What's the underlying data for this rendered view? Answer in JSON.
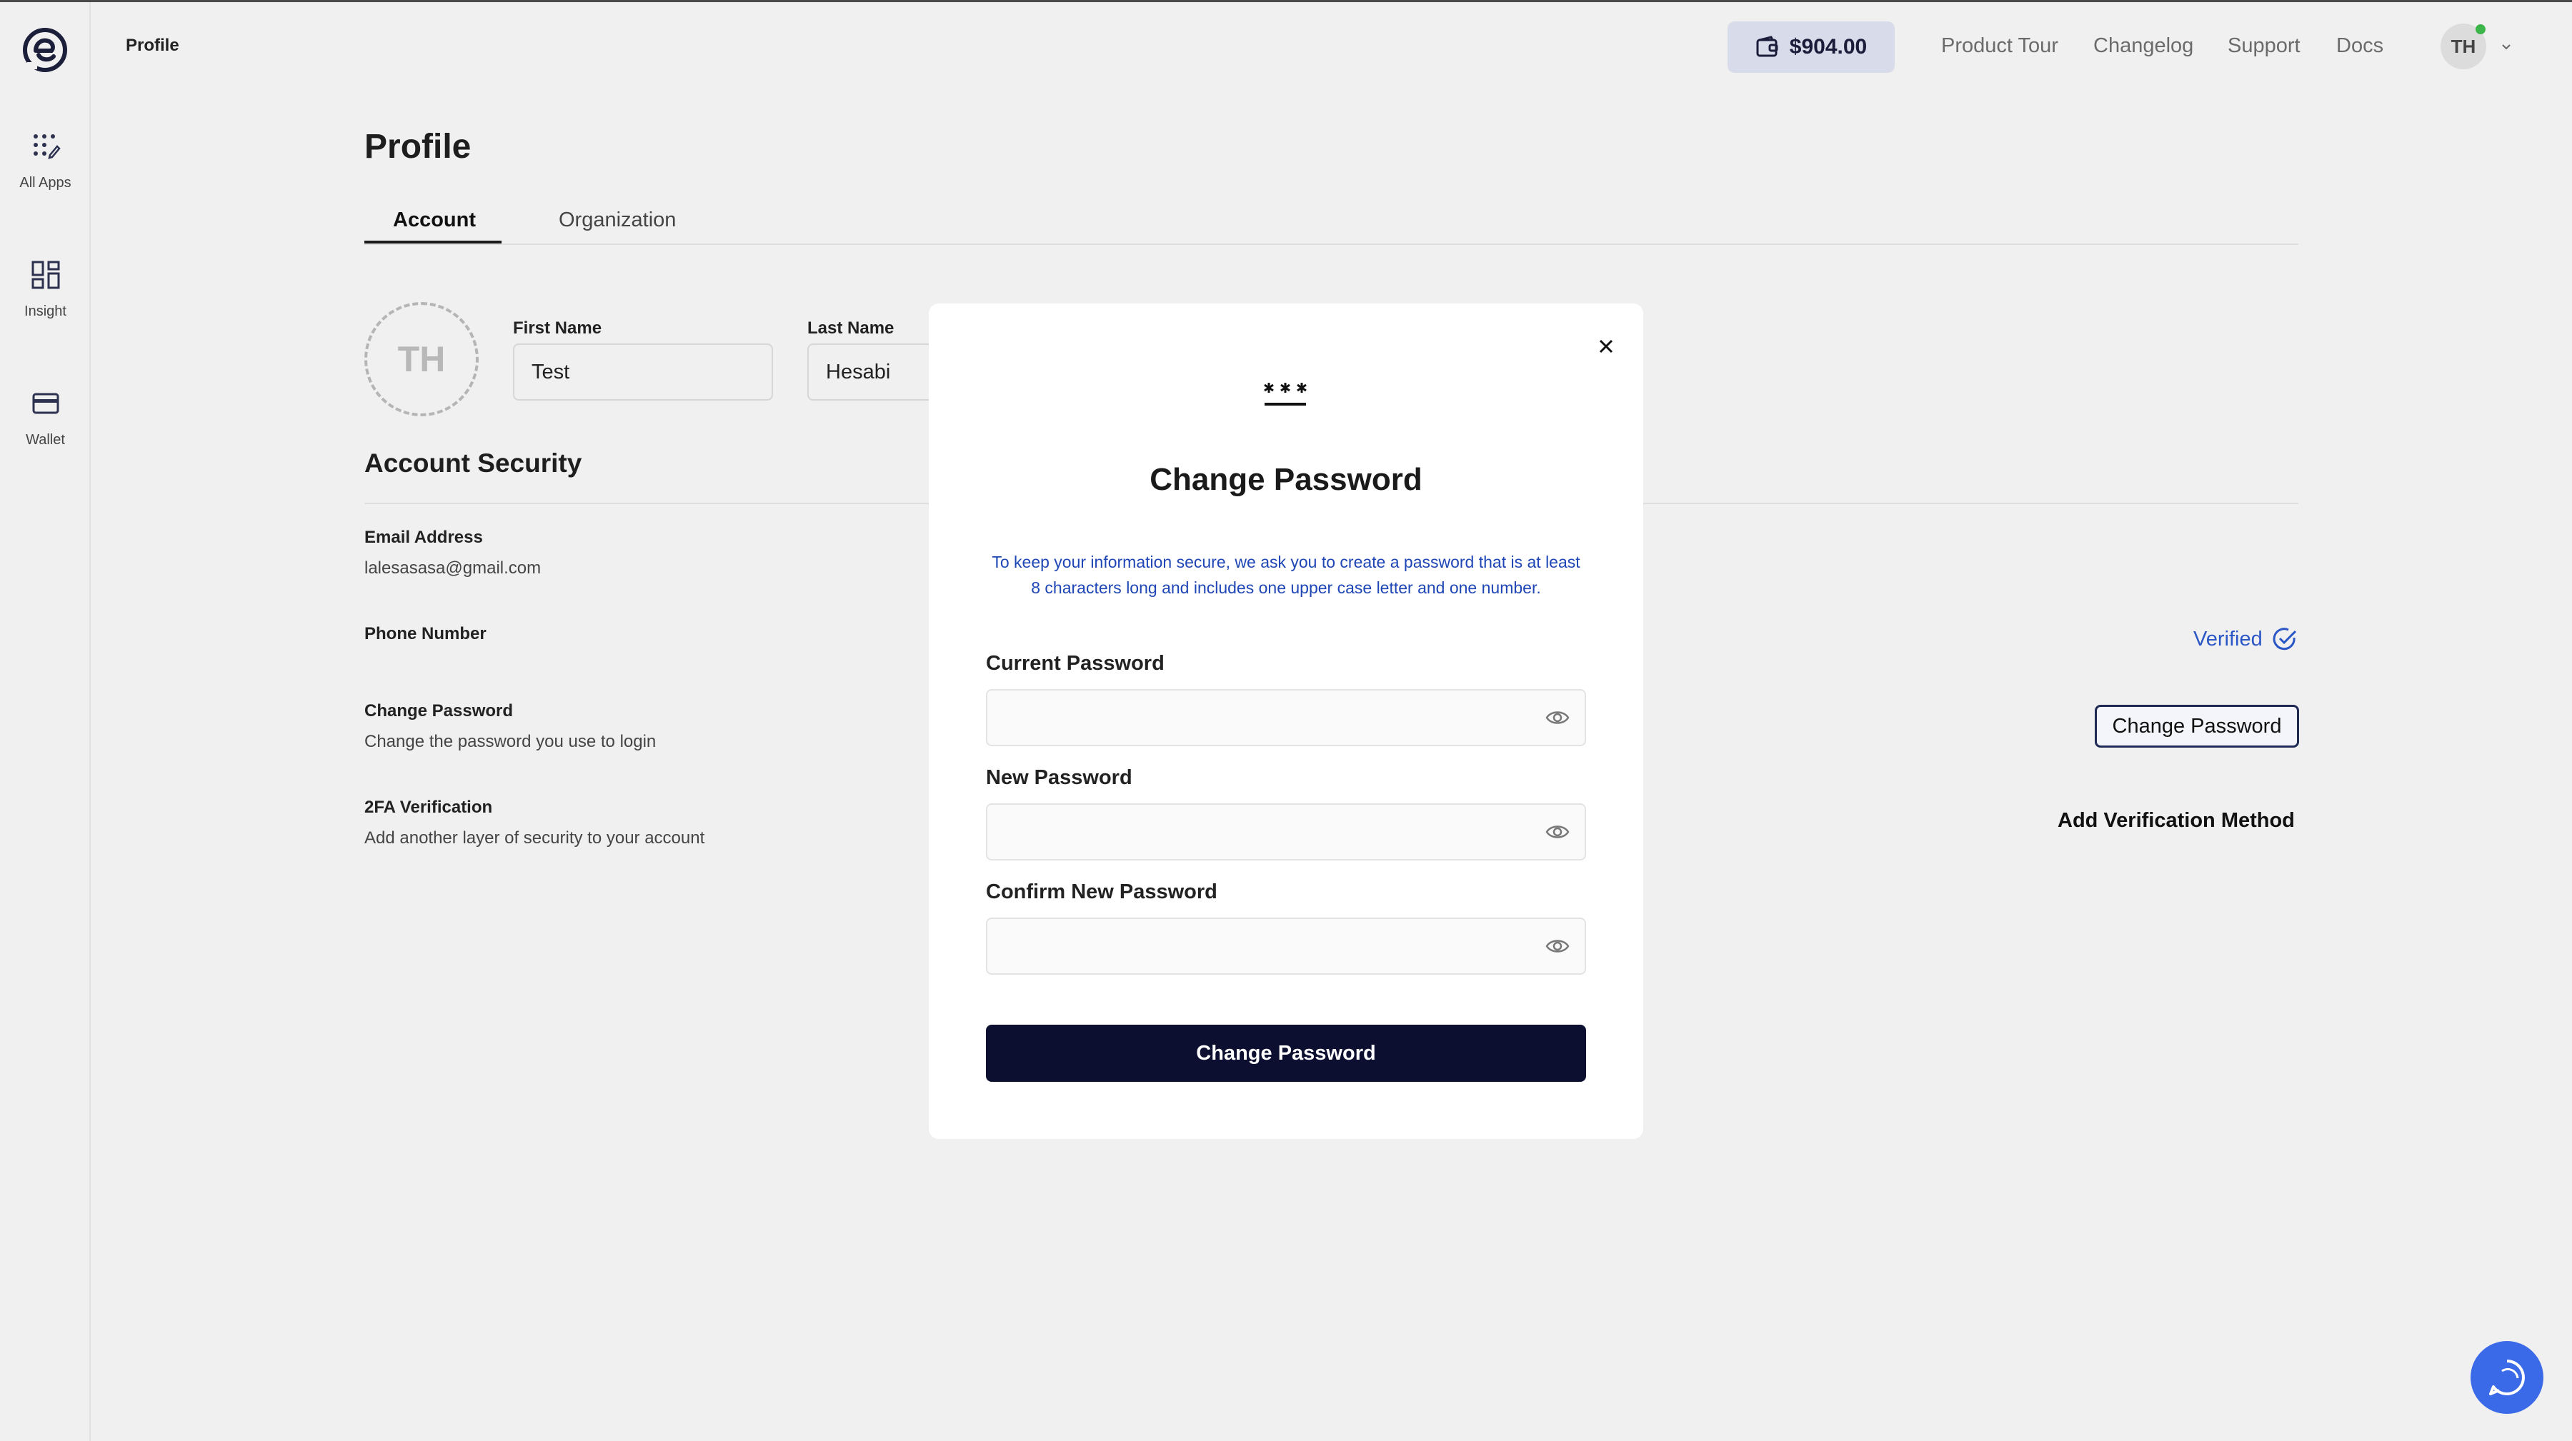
{
  "header": {
    "title": "Profile",
    "balance": "$904.00",
    "nav": [
      "Product Tour",
      "Changelog",
      "Support",
      "Docs"
    ],
    "avatar_initials": "TH"
  },
  "sidebar": {
    "items": [
      {
        "label": "All Apps",
        "icon": "apps-icon"
      },
      {
        "label": "Insight",
        "icon": "dashboard-icon"
      },
      {
        "label": "Wallet",
        "icon": "card-icon"
      }
    ]
  },
  "page": {
    "title": "Profile",
    "tabs": [
      {
        "label": "Account",
        "active": true
      },
      {
        "label": "Organization",
        "active": false
      }
    ],
    "avatar_initials": "TH",
    "first_name": {
      "label": "First Name",
      "value": "Test"
    },
    "last_name": {
      "label": "Last Name",
      "value": "Hesabi"
    },
    "security": {
      "title": "Account Security",
      "email": {
        "label": "Email Address",
        "value": "lalesasasa@gmail.com"
      },
      "phone": {
        "label": "Phone Number",
        "status": "Verified"
      },
      "password": {
        "label": "Change Password",
        "desc": "Change the password you use to login",
        "button": "Change Password"
      },
      "twofa": {
        "label": "2FA Verification",
        "desc": "Add another layer of security to your account",
        "action": "Add Verification Method"
      }
    }
  },
  "modal": {
    "title": "Change Password",
    "description": "To keep your information secure, we ask you to create a password that is at least 8 characters long and includes one upper case letter and one number.",
    "fields": [
      {
        "label": "Current Password",
        "placeholder": ""
      },
      {
        "label": "New Password",
        "placeholder": ""
      },
      {
        "label": "Confirm New Password",
        "placeholder": ""
      }
    ],
    "submit": "Change Password"
  },
  "colors": {
    "accent": "#0d0f30",
    "link_blue": "#2a56c6",
    "balance_bg": "#d8dbea",
    "chat_blue": "#3a6ae8",
    "online_green": "#3cb54a"
  }
}
